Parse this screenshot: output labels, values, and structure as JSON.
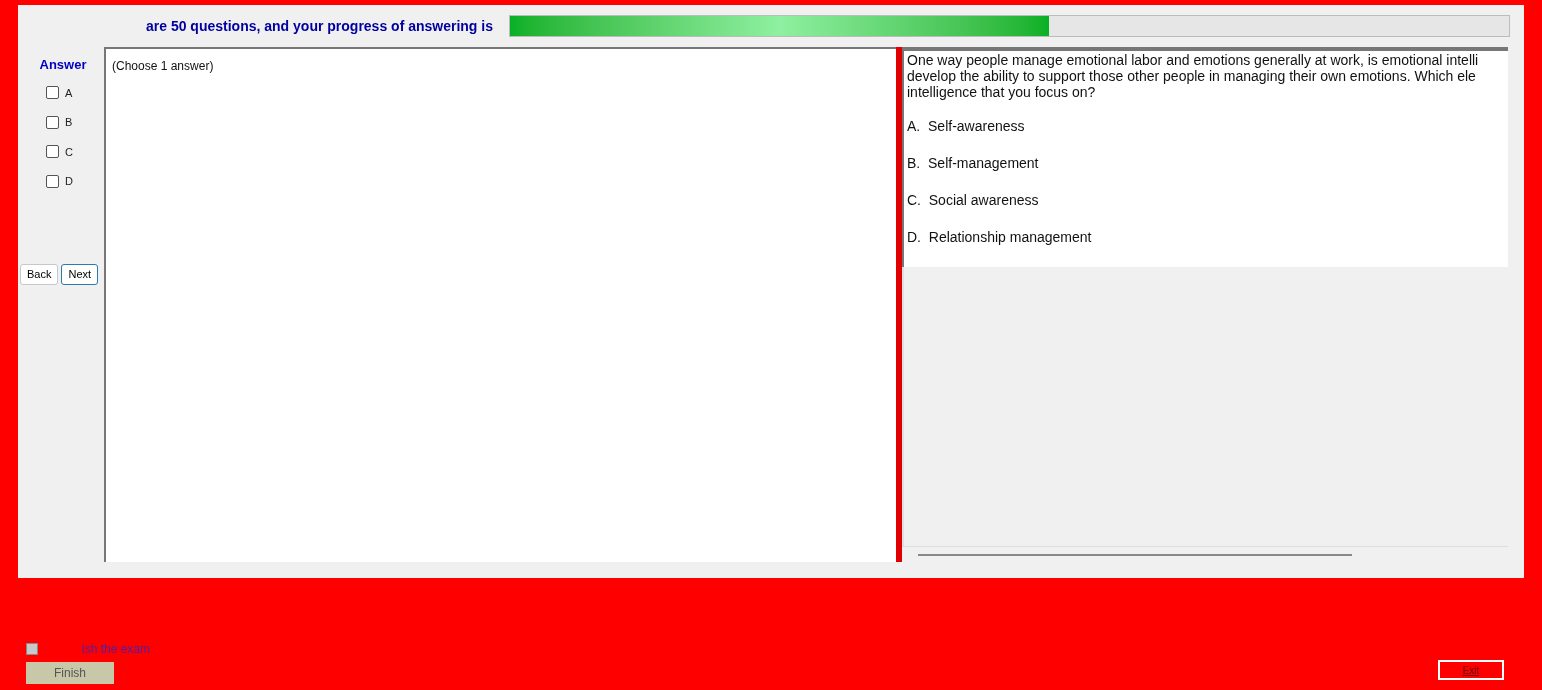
{
  "header": {
    "text": "are 50 questions, and your progress of answering is",
    "progress": {
      "level": 0.54
    }
  },
  "answer_panel": {
    "title": "Answer",
    "options": [
      {
        "label": "A",
        "checked": false
      },
      {
        "label": "B",
        "checked": false
      },
      {
        "label": "C",
        "checked": false
      },
      {
        "label": "D",
        "checked": false
      }
    ],
    "buttons": [
      {
        "label": "Back",
        "selected": false
      },
      {
        "label": "Next",
        "selected": true
      }
    ]
  },
  "answer_area": {
    "hint": "(Choose 1 answer)"
  },
  "question": {
    "text": "One way people manage emotional labor and emotions generally at work, is emotional intelli develop the ability to support those other people in managing their own emotions. Which ele intelligence that you focus on?",
    "choices": [
      "A.  Self-awareness",
      "B.  Self-management",
      "C.  Social awareness",
      "D.  Relationship management"
    ]
  },
  "footer": {
    "finish_check": {
      "label": "ish the exam",
      "checked": false
    },
    "finish_button": "Finish",
    "exit_button": "Exit"
  }
}
